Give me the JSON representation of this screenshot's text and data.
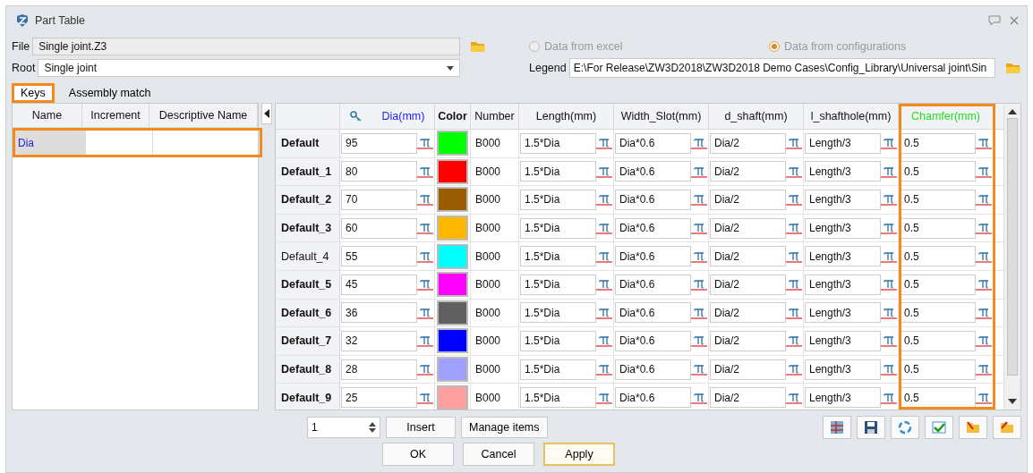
{
  "window": {
    "title": "Part Table"
  },
  "file": {
    "label": "File",
    "value": "Single joint.Z3"
  },
  "root": {
    "label": "Root",
    "value": "Single joint"
  },
  "source_options": [
    {
      "label": "Data from excel",
      "selected": false,
      "disabled": true
    },
    {
      "label": "Data from configurations",
      "selected": true,
      "disabled": true
    }
  ],
  "legend": {
    "label": "Legend",
    "value": "E:\\For Release\\ZW3D2018\\ZW3D2018 Demo Cases\\Config_Library\\Universal joint\\Sin"
  },
  "tabs": [
    {
      "label": "Keys",
      "selected": true,
      "highlighted": true
    },
    {
      "label": "Assembly match",
      "selected": false,
      "highlighted": false
    }
  ],
  "keys_table": {
    "columns": [
      "Name",
      "Increment",
      "Descriptive Name"
    ],
    "rows": [
      {
        "name": "Dia",
        "highlighted": true
      }
    ]
  },
  "table": {
    "columns": [
      {
        "label": "Dia(mm)",
        "kind": "formula",
        "color": "#1a1aff",
        "key": true,
        "bold": false,
        "highlighted": false
      },
      {
        "label": "Color",
        "kind": "color",
        "key": false,
        "bold": true,
        "highlighted": false
      },
      {
        "label": "Number",
        "kind": "text",
        "key": false,
        "bold": false,
        "highlighted": false
      },
      {
        "label": "Length(mm)",
        "kind": "formula",
        "key": false,
        "bold": false,
        "highlighted": false
      },
      {
        "label": "Width_Slot(mm)",
        "kind": "formula",
        "key": false,
        "bold": false,
        "highlighted": false
      },
      {
        "label": "d_shaft(mm)",
        "kind": "formula",
        "key": false,
        "bold": false,
        "highlighted": false
      },
      {
        "label": "l_shafthole(mm)",
        "kind": "formula",
        "key": false,
        "bold": false,
        "highlighted": false
      },
      {
        "label": "Chamfer(mm)",
        "kind": "formula",
        "color": "#22e022",
        "key": false,
        "bold": false,
        "highlighted": true
      }
    ],
    "rows": [
      {
        "label": "Default",
        "bold": true,
        "color": "#00ff00",
        "values": [
          "95",
          "B000",
          "1.5*Dia",
          "Dia*0.6",
          "Dia/2",
          "Length/3",
          "0.5"
        ]
      },
      {
        "label": "Default_1",
        "bold": true,
        "color": "#ff0000",
        "values": [
          "80",
          "B000",
          "1.5*Dia",
          "Dia*0.6",
          "Dia/2",
          "Length/3",
          "0.5"
        ]
      },
      {
        "label": "Default_2",
        "bold": true,
        "color": "#9a5c00",
        "values": [
          "70",
          "B000",
          "1.5*Dia",
          "Dia*0.6",
          "Dia/2",
          "Length/3",
          "0.5"
        ]
      },
      {
        "label": "Default_3",
        "bold": true,
        "color": "#ffb800",
        "values": [
          "60",
          "B000",
          "1.5*Dia",
          "Dia*0.6",
          "Dia/2",
          "Length/3",
          "0.5"
        ]
      },
      {
        "label": "Default_4",
        "bold": false,
        "color": "#00ffff",
        "values": [
          "55",
          "B000",
          "1.5*Dia",
          "Dia*0.6",
          "Dia/2",
          "Length/3",
          "0.5"
        ]
      },
      {
        "label": "Default_5",
        "bold": true,
        "color": "#ff00ff",
        "values": [
          "45",
          "B000",
          "1.5*Dia",
          "Dia*0.6",
          "Dia/2",
          "Length/3",
          "0.5"
        ]
      },
      {
        "label": "Default_6",
        "bold": true,
        "color": "#606060",
        "values": [
          "36",
          "B000",
          "1.5*Dia",
          "Dia*0.6",
          "Dia/2",
          "Length/3",
          "0.5"
        ]
      },
      {
        "label": "Default_7",
        "bold": true,
        "color": "#0000ff",
        "values": [
          "32",
          "B000",
          "1.5*Dia",
          "Dia*0.6",
          "Dia/2",
          "Length/3",
          "0.5"
        ]
      },
      {
        "label": "Default_8",
        "bold": true,
        "color": "#a0a0ff",
        "values": [
          "28",
          "B000",
          "1.5*Dia",
          "Dia*0.6",
          "Dia/2",
          "Length/3",
          "0.5"
        ]
      },
      {
        "label": "Default_9",
        "bold": true,
        "color": "#ffa0a0",
        "values": [
          "25",
          "B000",
          "1.5*Dia",
          "Dia*0.6",
          "Dia/2",
          "Length/3",
          "0.5"
        ]
      }
    ]
  },
  "spinner": {
    "value": "1"
  },
  "insert_button": "Insert",
  "manage_button": "Manage items",
  "buttons": [
    {
      "label": "OK",
      "default": false
    },
    {
      "label": "Cancel",
      "default": false
    },
    {
      "label": "Apply",
      "default": true
    }
  ]
}
